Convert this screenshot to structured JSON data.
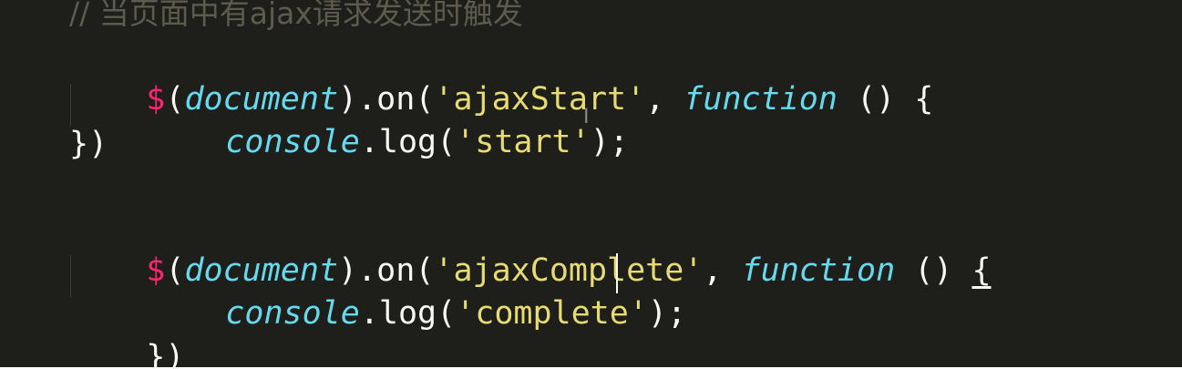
{
  "editor": {
    "comment_line": "// 当页面中有ajax请求发送时触发",
    "block1": {
      "dollar": "$",
      "open_paren": "(",
      "document": "document",
      "close_dot_on": ").on(",
      "event": "'ajaxStart'",
      "comma": ", ",
      "function_kw": "function",
      "params_brace": " () {",
      "console": "console",
      "log_open": ".log(",
      "message": "'start'",
      "log_close": ");",
      "closing": "})"
    },
    "block2": {
      "dollar": "$",
      "open_paren": "(",
      "document": "document",
      "close_dot_on": ").on(",
      "event": "'ajaxComplete'",
      "comma": ", ",
      "function_kw": "function",
      "params": " () ",
      "open_brace": "{",
      "console": "console",
      "log_open": ".log(",
      "message": "'complete'",
      "log_close": ");",
      "closing_brace": "}",
      "closing_paren": ")"
    },
    "mouse_cursor_glyph": "I"
  },
  "colors": {
    "background": "#1e1f1a",
    "keyword_pink": "#f92672",
    "identifier_cyan": "#66d9ef",
    "string_yellow": "#e6db74",
    "text": "#f8f8f2",
    "comment": "#5b5b4e"
  }
}
